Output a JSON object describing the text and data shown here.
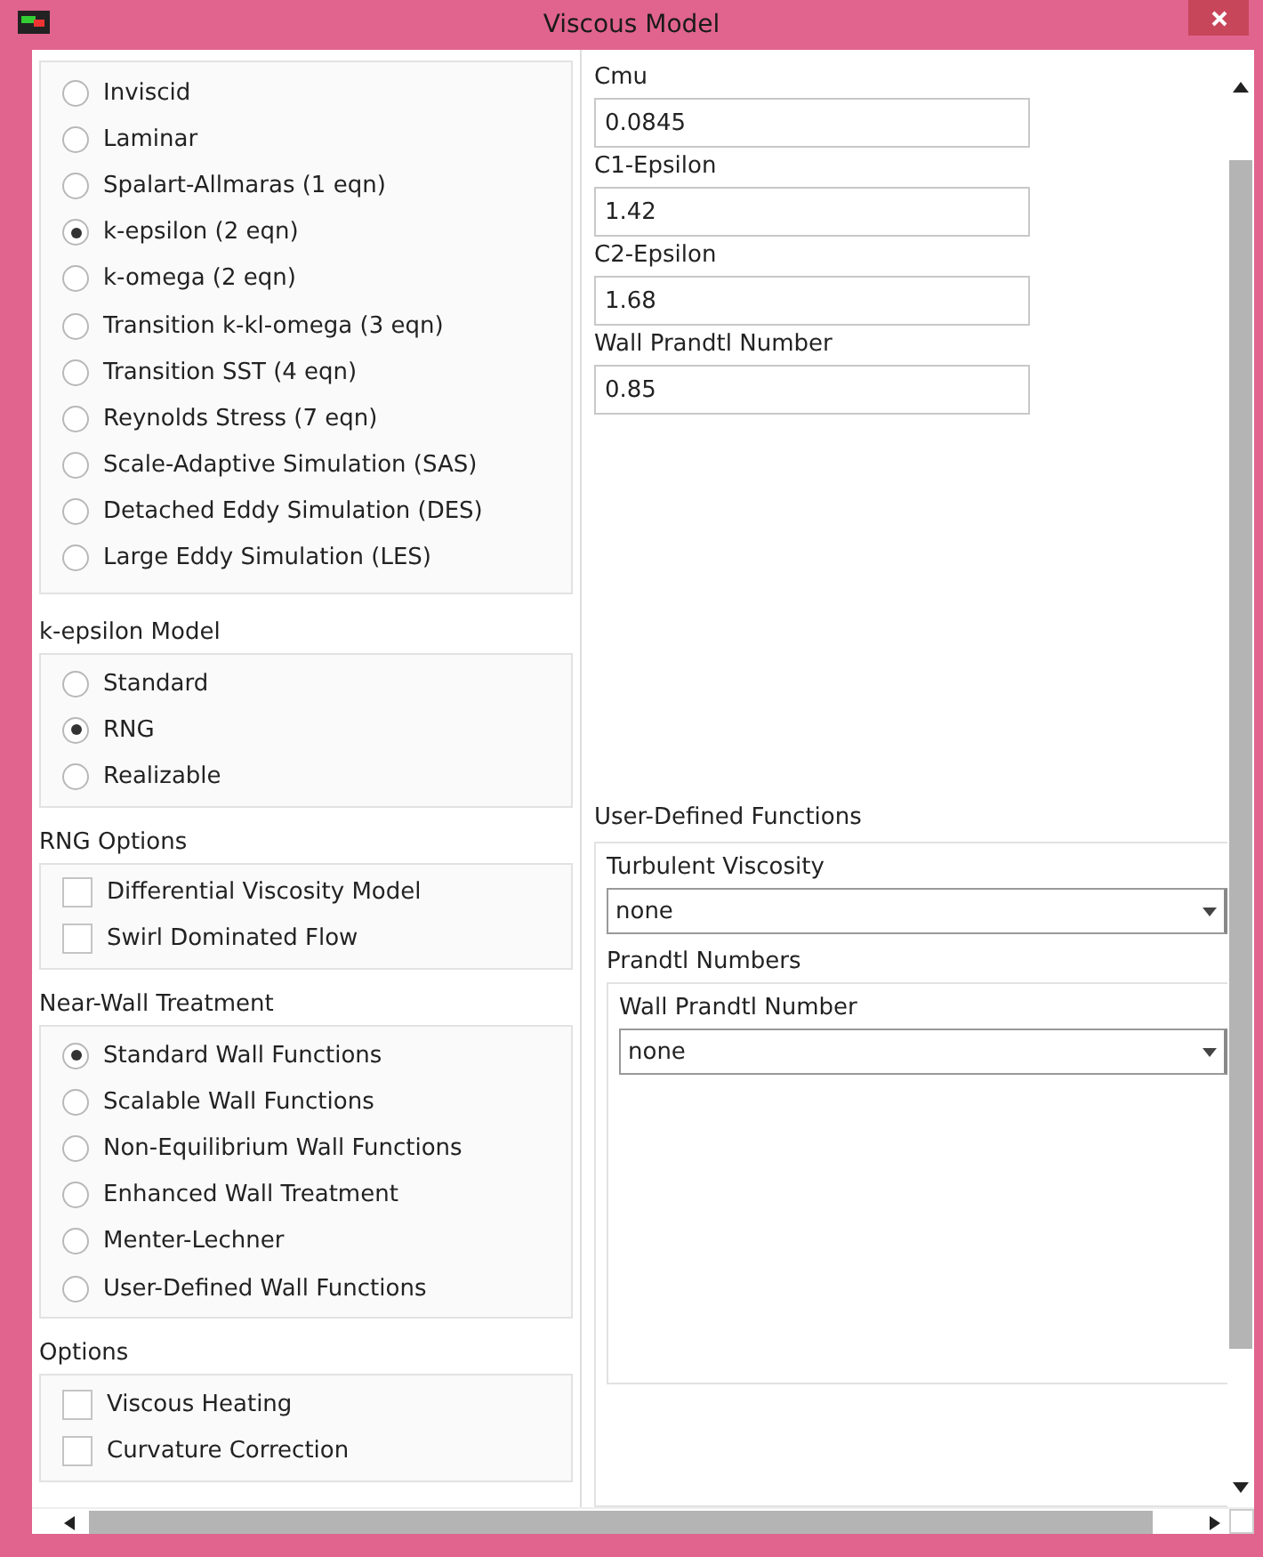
{
  "window": {
    "title": "Viscous Model"
  },
  "model": {
    "options": [
      {
        "label": "Inviscid",
        "selected": false
      },
      {
        "label": "Laminar",
        "selected": false
      },
      {
        "label": "Spalart-Allmaras (1 eqn)",
        "selected": false
      },
      {
        "label": "k-epsilon (2 eqn)",
        "selected": true
      },
      {
        "label": "k-omega (2 eqn)",
        "selected": false
      },
      {
        "label": "Transition k-kl-omega (3 eqn)",
        "selected": false
      },
      {
        "label": "Transition SST (4 eqn)",
        "selected": false
      },
      {
        "label": "Reynolds Stress (7 eqn)",
        "selected": false
      },
      {
        "label": "Scale-Adaptive Simulation (SAS)",
        "selected": false
      },
      {
        "label": "Detached Eddy Simulation (DES)",
        "selected": false
      },
      {
        "label": "Large Eddy Simulation (LES)",
        "selected": false
      }
    ]
  },
  "k_epsilon_model": {
    "label": "k-epsilon Model",
    "options": [
      {
        "label": "Standard",
        "selected": false
      },
      {
        "label": "RNG",
        "selected": true
      },
      {
        "label": "Realizable",
        "selected": false
      }
    ]
  },
  "rng_options": {
    "label": "RNG Options",
    "items": [
      {
        "label": "Differential Viscosity Model",
        "checked": false
      },
      {
        "label": "Swirl Dominated Flow",
        "checked": false
      }
    ]
  },
  "near_wall_treatment": {
    "label": "Near-Wall Treatment",
    "options": [
      {
        "label": "Standard Wall Functions",
        "selected": true
      },
      {
        "label": "Scalable Wall Functions",
        "selected": false
      },
      {
        "label": "Non-Equilibrium Wall Functions",
        "selected": false
      },
      {
        "label": "Enhanced Wall Treatment",
        "selected": false
      },
      {
        "label": "Menter-Lechner",
        "selected": false
      },
      {
        "label": "User-Defined Wall Functions",
        "selected": false
      }
    ]
  },
  "options": {
    "label": "Options",
    "items": [
      {
        "label": "Viscous Heating",
        "checked": false
      },
      {
        "label": "Curvature Correction",
        "checked": false
      }
    ]
  },
  "model_constants": [
    {
      "label": "Cmu",
      "value": "0.0845"
    },
    {
      "label": "C1-Epsilon",
      "value": "1.42"
    },
    {
      "label": "C2-Epsilon",
      "value": "1.68"
    },
    {
      "label": "Wall Prandtl Number",
      "value": "0.85"
    }
  ],
  "user_defined_functions": {
    "label": "User-Defined Functions",
    "turbulent_viscosity": {
      "label": "Turbulent Viscosity",
      "value": "none"
    },
    "prandtl_numbers": {
      "label": "Prandtl Numbers",
      "wall_prandtl_number": {
        "label": "Wall Prandtl Number",
        "value": "none"
      }
    }
  }
}
